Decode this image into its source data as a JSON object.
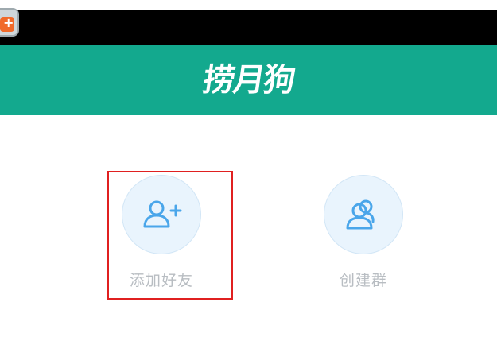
{
  "app": {
    "title": "捞月狗",
    "badge_icon": "app-launcher-plus-icon"
  },
  "colors": {
    "header": "#13a98e",
    "status_bar": "#000000",
    "icon_stroke": "#4aa6ea",
    "icon_bg": "#e9f4fd",
    "label": "#b8bdc2",
    "highlight": "#e02020"
  },
  "actions": [
    {
      "label": "添加好友",
      "icon": "add-friend-icon"
    },
    {
      "label": "创建群",
      "icon": "create-group-icon"
    }
  ]
}
